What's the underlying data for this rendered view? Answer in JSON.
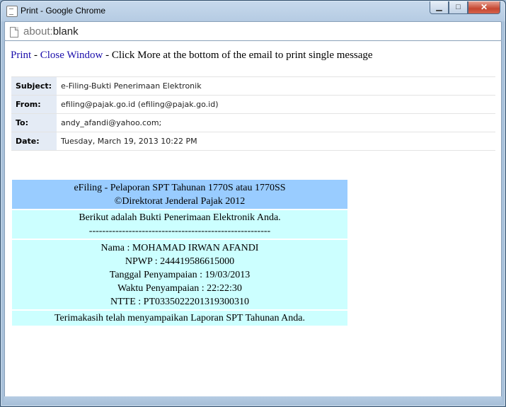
{
  "window": {
    "title": "Print - Google Chrome",
    "controls": {
      "minimize": "▁",
      "maximize": "□",
      "close": "✕"
    }
  },
  "address": {
    "scheme": "about:",
    "path": "blank"
  },
  "toolbar": {
    "print_label": "Print",
    "sep1": " - ",
    "close_label": "Close Window",
    "hint": " - Click More at the bottom of the email to print single message"
  },
  "headers": [
    {
      "key": "Subject:",
      "value": "e-Filing-Bukti Penerimaan Elektronik"
    },
    {
      "key": "From:",
      "value": "efiling@pajak.go.id (efiling@pajak.go.id)"
    },
    {
      "key": "To:",
      "value": "andy_afandi@yahoo.com;"
    },
    {
      "key": "Date:",
      "value": "Tuesday, March 19, 2013 10:22 PM"
    }
  ],
  "body": {
    "banner_line1": "eFiling - Pelaporan SPT Tahunan 1770S atau 1770SS",
    "banner_line2": "©Direktorat Jenderal Pajak 2012",
    "intro_line1": "Berikut adalah Bukti Penerimaan Elektronik Anda.",
    "intro_line2": "-------------------------------------------------------",
    "nama": "Nama : MOHAMAD IRWAN AFANDI",
    "npwp": "NPWP : 244419586615000",
    "tanggal": "Tanggal Penyampaian : 19/03/2013",
    "waktu": "Waktu Penyampaian : 22:22:30",
    "ntte": "NTTE : PT0335022201319300310",
    "closing": "Terimakasih telah menyampaikan Laporan SPT Tahunan Anda."
  },
  "colors": {
    "banner": "#99ccff",
    "body_block": "#ccffff",
    "header_key_bg": "#e4ebf5",
    "link": "#1a0dab"
  }
}
